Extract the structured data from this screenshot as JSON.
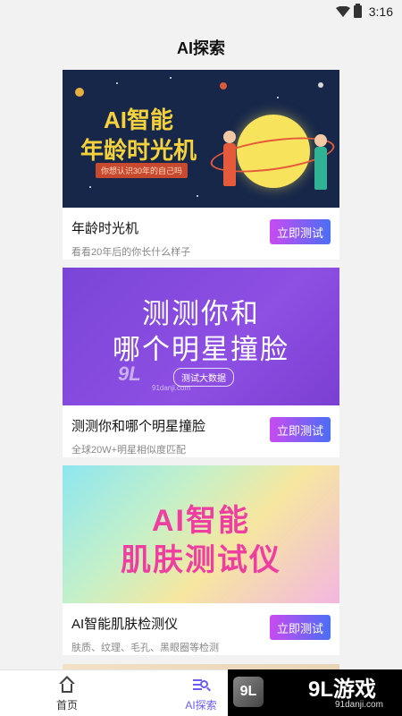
{
  "status": {
    "time": "3:16",
    "wifi_icon": "wifi-icon",
    "battery_icon": "battery-icon"
  },
  "page": {
    "title": "AI探索"
  },
  "cards": [
    {
      "banner": {
        "line1": "AI智能",
        "line2": "年龄时光机",
        "tag": "你想认识30年的自己吗"
      },
      "name": "年龄时光机",
      "desc": "看看20年后的你长什么样子",
      "button": "立即测试"
    },
    {
      "banner": {
        "line1": "测测你和",
        "line2": "哪个明星撞脸",
        "tag": "测试大数据",
        "watermark": "9L",
        "watermark_url": "91danji.com"
      },
      "name": "测测你和哪个明星撞脸",
      "desc": "全球20W+明星相似度匹配",
      "button": "立即测试"
    },
    {
      "banner": {
        "line1": "AI智能",
        "line2": "肌肤测试仪"
      },
      "name": "AI智能肌肤检测仪",
      "desc": "肤质、纹理、毛孔、黑眼圈等检测",
      "button": "立即测试"
    }
  ],
  "tabbar": {
    "items": [
      {
        "label": "首页",
        "icon": "home-icon",
        "active": false
      },
      {
        "label": "AI探索",
        "icon": "ai-search-icon",
        "active": true
      }
    ]
  },
  "watermark": {
    "badge": "9L",
    "brand": "9L游戏",
    "url": "91danji.com"
  },
  "colors": {
    "accent": "#6a5cf0",
    "button_start": "#c84bf0",
    "button_end": "#4b6ef5",
    "background": "#f2f2f2"
  }
}
